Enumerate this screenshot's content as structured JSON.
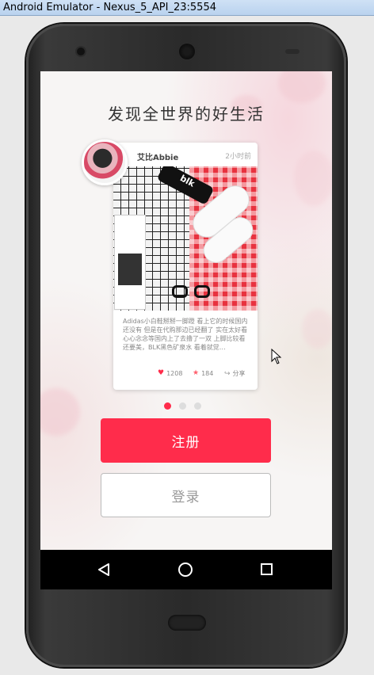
{
  "window": {
    "title": "Android Emulator - Nexus_5_API_23:5554"
  },
  "app": {
    "headline": "发现全世界的好生活",
    "card": {
      "user_name": "艾比Abbie",
      "time": "2小时前",
      "photo_alt": "blk",
      "description": "Adidas小白鞋掰掰一脚蹬 看上它的时候国内还没有 但是在代购那边已经翻了 实在太好看 心心念念等国内上了去撸了一双 上脚比较看还要美，BLK黑色矿泉水 看着就觉…",
      "likes": "1208",
      "stars": "184",
      "share_label": "分享"
    },
    "pagination": {
      "active_index": 0,
      "count": 3
    },
    "register_label": "注册",
    "login_label": "登录"
  },
  "colors": {
    "accent": "#ff2c4b",
    "nav_bg": "#000000"
  }
}
